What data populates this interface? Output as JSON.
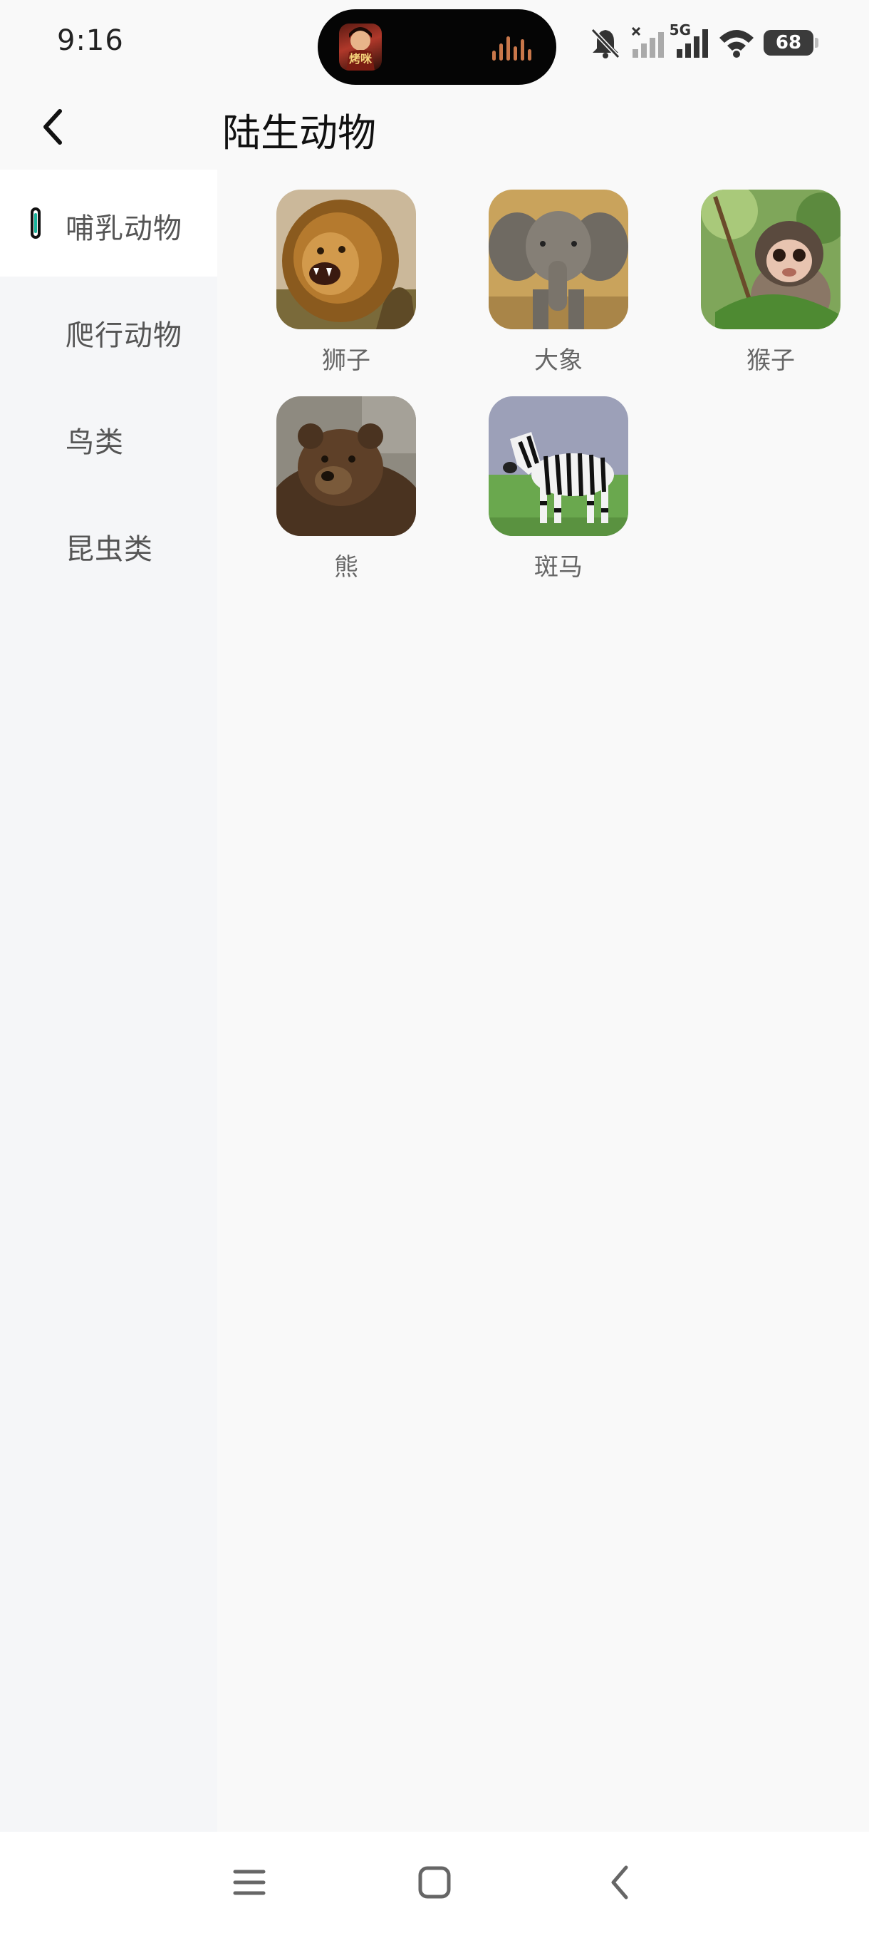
{
  "status_bar": {
    "time": "9:16",
    "network": "5G",
    "battery": "68",
    "island_app_text": "烤咪"
  },
  "header": {
    "title": "陆生动物"
  },
  "sidebar": {
    "items": [
      {
        "label": "哺乳动物",
        "active": true
      },
      {
        "label": "爬行动物",
        "active": false
      },
      {
        "label": "鸟类",
        "active": false
      },
      {
        "label": "昆虫类",
        "active": false
      }
    ]
  },
  "grid": {
    "items": [
      {
        "label": "狮子",
        "icon": "lion-photo"
      },
      {
        "label": "大象",
        "icon": "elephant-photo"
      },
      {
        "label": "猴子",
        "icon": "monkey-photo"
      },
      {
        "label": "熊",
        "icon": "bear-photo"
      },
      {
        "label": "斑马",
        "icon": "zebra-photo"
      }
    ]
  },
  "colors": {
    "accent": "#19b39b",
    "sidebar_bg": "#f5f6f8",
    "content_bg": "#f9f9f9"
  }
}
